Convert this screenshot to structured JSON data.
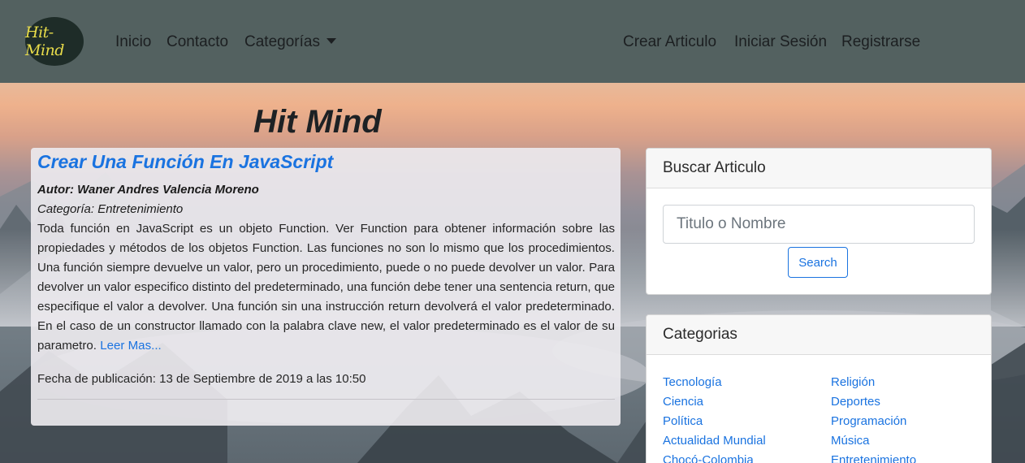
{
  "navbar": {
    "logo_text": "Hit-Mind",
    "links": {
      "home": "Inicio",
      "contact": "Contacto",
      "categories": "Categorías",
      "create_article": "Crear Articulo",
      "login": "Iniciar Sesión",
      "register": "Registrarse"
    }
  },
  "page": {
    "site_title": "Hit Mind"
  },
  "article": {
    "title": "Crear Una Función En JavaScript",
    "author": "Autor: Waner Andres Valencia Moreno",
    "category": "Categoría: Entretenimiento",
    "excerpt": "Toda función en JavaScript es un objeto Function. Ver Function para obtener información sobre las propiedades y métodos de los objetos Function. Las funciones no son lo mismo que los procedimientos. Una función siempre devuelve un valor, pero un procedimiento, puede o no puede devolver un valor. Para devolver un valor especifico distinto del predeterminado, una función debe tener una sentencia return, que especifique el valor a devolver. Una función sin una instrucción return devolverá el valor predeterminado. En el caso de un constructor llamado con la palabra clave new, el valor predeterminado es el valor de su parametro.",
    "read_more": "Leer Mas...",
    "published": "Fecha de publicación: 13 de Septiembre de 2019 a las 10:50"
  },
  "search": {
    "header": "Buscar Articulo",
    "placeholder": "Titulo o Nombre",
    "button": "Search"
  },
  "categories": {
    "header": "Categorias",
    "left": [
      "Tecnología",
      "Ciencia",
      "Política",
      "Actualidad Mundial",
      "Chocó-Colombia"
    ],
    "right": [
      "Religión",
      "Deportes",
      "Programación",
      "Música",
      "Entretenimiento"
    ]
  },
  "colors": {
    "navbar_bg": "#536160",
    "link_blue": "#1a73e0",
    "logo_text": "#e8dc4a"
  }
}
